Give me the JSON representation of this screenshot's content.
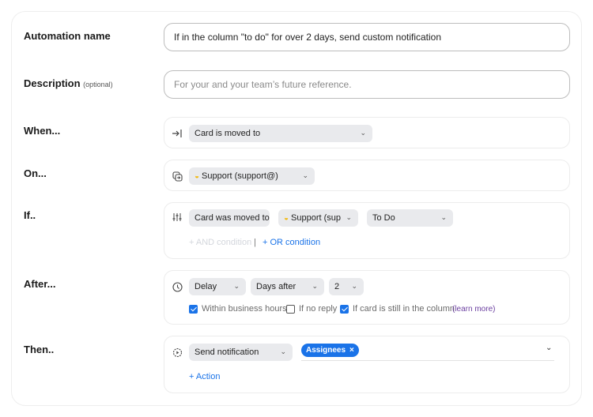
{
  "form": {
    "name": {
      "label": "Automation name",
      "value": "If in the column \"to do\" for over 2 days, send custom notification"
    },
    "description": {
      "label": "Description",
      "optional": "(optional)",
      "placeholder": "For your and your team’s future reference.",
      "value": ""
    },
    "when": {
      "label": "When...",
      "icon": "arrow-to-bar-icon",
      "trigger": "Card is moved to"
    },
    "on": {
      "label": "On...",
      "icon": "inbox-switch-icon",
      "inbox_emoji": "handshake-emoji",
      "inbox": "Support (support@)"
    },
    "if": {
      "label": "If..",
      "icon": "sliders-icon",
      "condition": "Card was moved to",
      "inbox": "Support (sup",
      "column": "To Do",
      "and_condition": "+ AND condition",
      "separator": "|",
      "or_condition": "+ OR condition"
    },
    "after": {
      "label": "After...",
      "icon": "clock-icon",
      "delay": "Delay",
      "unit": "Days after",
      "amount": "2",
      "options": [
        {
          "label": "Within business hours",
          "checked": true
        },
        {
          "label": "If no reply",
          "checked": false
        },
        {
          "label": "If card is still in the column",
          "checked": true
        }
      ],
      "learn_more": "(learn more)"
    },
    "then": {
      "label": "Then..",
      "icon": "gear-play-icon",
      "action": "Send notification",
      "recipients": [
        "Assignees"
      ],
      "add_action": "+ Action"
    }
  },
  "colors": {
    "accent": "#1a73e8",
    "link_purple": "#6b3fa0",
    "select_bg": "#e9eaed"
  }
}
